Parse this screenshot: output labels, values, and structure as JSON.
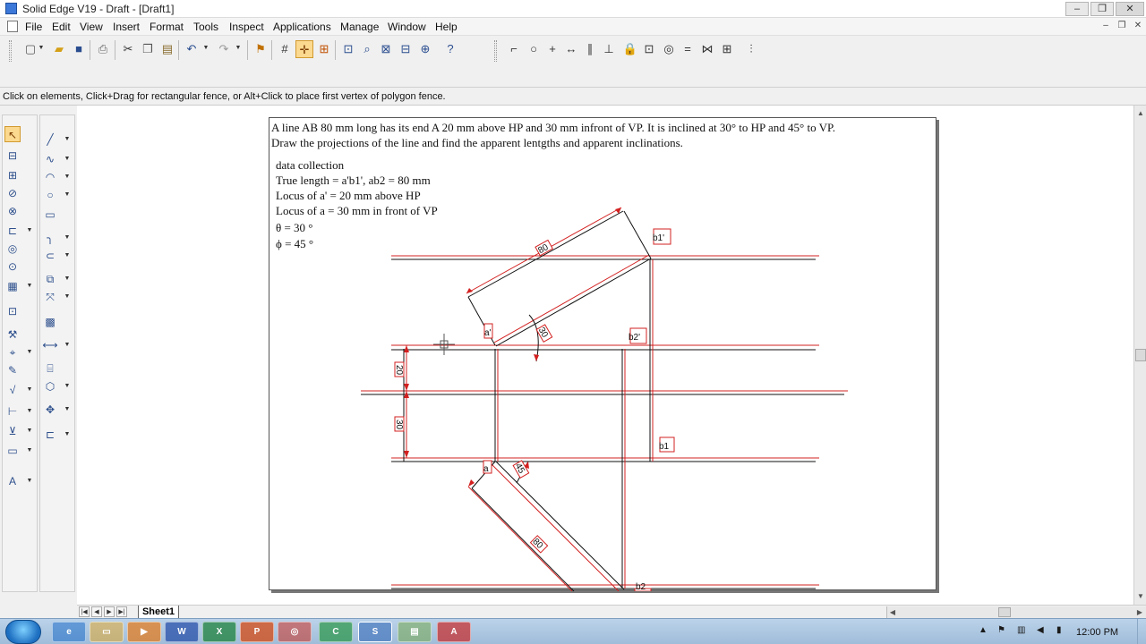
{
  "window": {
    "title": "Solid Edge V19 - Draft - [Draft1]",
    "minimize_glyph": "–",
    "restore_glyph": "❐",
    "close_glyph": "✕"
  },
  "menu": {
    "items": [
      "File",
      "Edit",
      "View",
      "Insert",
      "Format",
      "Tools",
      "Inspect",
      "Applications",
      "Manage",
      "Window",
      "Help"
    ]
  },
  "toolbar": {
    "icons": [
      "new-icon",
      "open-icon",
      "save-icon",
      "print-icon",
      "cut-icon",
      "copy-icon",
      "paste-icon",
      "undo-icon",
      "redo-icon",
      "flag-icon",
      "grid-icon",
      "intellisketch-icon",
      "tear-off-icon",
      "zoom-area-icon",
      "zoom-icon",
      "fit-icon",
      "pan-icon",
      "whats-this-icon"
    ],
    "relation_icons": [
      "connect-icon",
      "tangent-icon",
      "point-on-icon",
      "horizontal-vertical-icon",
      "parallel-icon",
      "perpendicular-icon",
      "lock-icon",
      "rigid-set-icon",
      "concentric-icon",
      "equal-icon",
      "symmetric-icon",
      "symmetry-axis-icon",
      "collinear-icon"
    ]
  },
  "prompt": {
    "text": "Click on elements, Click+Drag for rectangular fence, or Alt+Click to place first vertex of polygon fence."
  },
  "sheet": {
    "problem_line1": "A line AB 80 mm long has its end A 20 mm above HP and 30 mm infront of VP. It is inclined at 30° to HP and 45° to VP.",
    "problem_line2": "Draw the projections of the line and find the apparent lentgths and apparent inclinations.",
    "data_lines": [
      "data collection",
      "True length = a'b1', ab2 = 80 mm",
      "Locus of a' = 20 mm above HP",
      "Locus of a = 30 mm in front of VP",
      "θ = 30 °",
      "ϕ = 45 °"
    ],
    "labels": {
      "b1_prime": "b1'",
      "b2_prime": "b2'",
      "b1": "b1",
      "b2": "b2",
      "a_prime": "a'",
      "a": "a",
      "dim_80": "80",
      "dim_20": "20",
      "dim_30": "30",
      "angle_30": "30",
      "angle_45": "45"
    }
  },
  "tabs": {
    "sheet1": "Sheet1"
  },
  "taskbar": {
    "apps": [
      "ie-icon",
      "explorer-icon",
      "media-icon",
      "word-icon",
      "excel-icon",
      "powerpoint-icon",
      "chrome-icon",
      "camtasia-icon",
      "solidedge-icon",
      "folder-icon",
      "pdf-icon"
    ],
    "app_glyphs": [
      "e",
      "▭",
      "▶",
      "W",
      "X",
      "P",
      "◎",
      "C",
      "S",
      "▤",
      "A"
    ],
    "clock": "12:00 PM"
  },
  "colors": {
    "accent_red": "#d32020",
    "line_black": "#111111",
    "active_tool": "#fbd98f"
  }
}
